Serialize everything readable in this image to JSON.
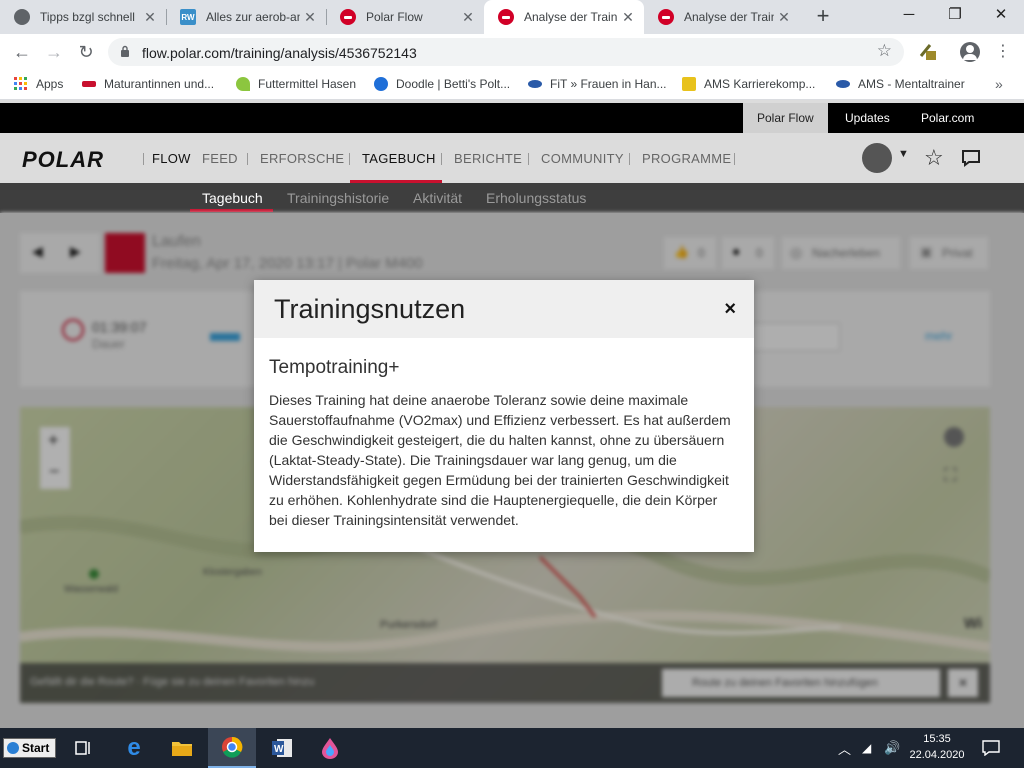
{
  "browser": {
    "tabs": [
      {
        "title": "Tipps bzgl schnell",
        "favicon": "globe-icon"
      },
      {
        "title": "Alles zur aerob-an",
        "favicon": "rw-icon"
      },
      {
        "title": "Polar Flow",
        "favicon": "polar-icon"
      },
      {
        "title": "Analyse der Traini",
        "favicon": "polar-icon",
        "active": true
      },
      {
        "title": "Analyse der Traini",
        "favicon": "polar-icon"
      }
    ],
    "url": "flow.polar.com/training/analysis/4536752143",
    "bookmarks": [
      {
        "label": "Apps",
        "color": "#e8453c"
      },
      {
        "label": "Maturantinnen und...",
        "color": "#c8102e"
      },
      {
        "label": "Futtermittel Hasen",
        "color": "#8cc63f"
      },
      {
        "label": "Doodle | Betti's Polt...",
        "color": "#1f6fd8"
      },
      {
        "label": "FiT » Frauen in Han...",
        "color": "#2a5aa8"
      },
      {
        "label": "AMS Karrierekomp...",
        "color": "#e8c21c"
      },
      {
        "label": "AMS - Mentaltrainer",
        "color": "#2a5aa8"
      }
    ]
  },
  "polar": {
    "topbar": {
      "links": [
        "Polar Flow",
        "Updates",
        "Polar.com"
      ]
    },
    "logo": "POLAR",
    "nav": [
      "FLOW",
      "FEED",
      "ERFORSCHE",
      "TAGEBUCH",
      "BERICHTE",
      "COMMUNITY",
      "PROGRAMME"
    ],
    "subnav": [
      "Tagebuch",
      "Trainingshistorie",
      "Aktivität",
      "Erholungsstatus"
    ],
    "activity": {
      "sport": "Laufen",
      "meta": "Freitag, Apr 17, 2020 13:17 | Polar M400",
      "duration": "01:39:07",
      "duration_label": "Dauer",
      "likes": "0",
      "comments": "0",
      "redo_label": "Nacherleben",
      "privacy_label": "Privat",
      "more_label": "mehr"
    },
    "map": {
      "footer_text": "Gefällt dir die Route? · Füge sie zu deinen Favoriten hinzu",
      "fav_button": "Route zu deinen Favoriten hinzufügen",
      "places": [
        "Wasserwald",
        "Klostergaben",
        "Purkersdorf",
        "Wi"
      ]
    }
  },
  "modal": {
    "title": "Trainingsnutzen",
    "close": "×",
    "subtitle": "Tempotraining+",
    "body": "Dieses Training hat deine anaerobe Toleranz sowie deine maximale Sauerstoffaufnahme (VO2max) und Effizienz verbessert. Es hat außerdem die Geschwindigkeit gesteigert, die du halten kannst, ohne zu übersäuern (Laktat-Steady-State). Die Trainingsdauer war lang genug, um die Widerstandsfähigkeit gegen Ermüdung bei der trainierten Geschwindigkeit zu erhöhen. Kohlenhydrate sind die Hauptenergiequelle, die dein Körper bei dieser Trainingsintensität verwendet."
  },
  "taskbar": {
    "start_label": "Start",
    "time": "15:35",
    "date": "22.04.2020"
  }
}
